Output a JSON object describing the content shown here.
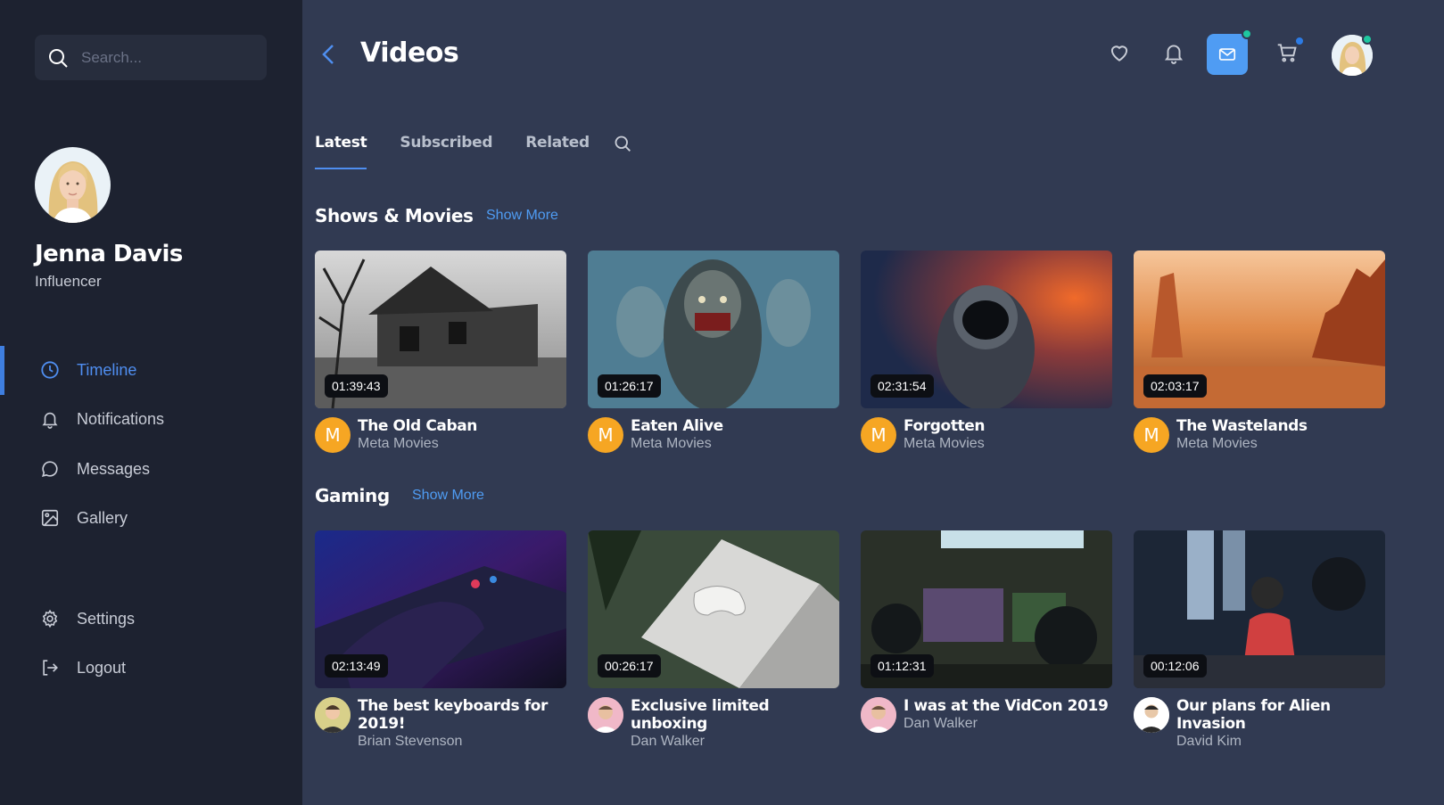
{
  "sidebar": {
    "search_placeholder": "Search...",
    "profile": {
      "name": "Jenna Davis",
      "role": "Influencer"
    },
    "nav": [
      {
        "label": "Timeline",
        "icon": "clock-icon",
        "active": true
      },
      {
        "label": "Notifications",
        "icon": "bell-icon"
      },
      {
        "label": "Messages",
        "icon": "chat-bubble-icon"
      },
      {
        "label": "Gallery",
        "icon": "image-icon"
      }
    ],
    "bottom_nav": [
      {
        "label": "Settings",
        "icon": "gear-icon"
      },
      {
        "label": "Logout",
        "icon": "logout-icon"
      }
    ]
  },
  "header": {
    "title": "Videos",
    "icons": [
      "heart-icon",
      "bell-icon",
      "mail-icon",
      "cart-icon"
    ],
    "accent": "#4f9cf3",
    "badge_colors": {
      "mail": "#1fc8a0",
      "cart": "#2c7be5",
      "avatar": "#1fc8a0"
    }
  },
  "tabs": [
    {
      "label": "Latest",
      "active": true
    },
    {
      "label": "Subscribed"
    },
    {
      "label": "Related"
    }
  ],
  "sections": [
    {
      "title": "Shows & Movies",
      "show_more": "Show More",
      "videos": [
        {
          "title": "The Old Caban",
          "channel": "Meta Movies",
          "duration": "01:39:43"
        },
        {
          "title": "Eaten Alive",
          "channel": "Meta Movies",
          "duration": "01:26:17"
        },
        {
          "title": "Forgotten",
          "channel": "Meta Movies",
          "duration": "02:31:54"
        },
        {
          "title": "The Wastelands",
          "channel": "Meta Movies",
          "duration": "02:03:17"
        }
      ]
    },
    {
      "title": "Gaming",
      "show_more": "Show More",
      "videos": [
        {
          "title": "The best keyboards for 2019!",
          "channel": "Brian Stevenson",
          "duration": "02:13:49"
        },
        {
          "title": "Exclusive limited unboxing",
          "channel": "Dan Walker",
          "duration": "00:26:17"
        },
        {
          "title": "I was at the VidCon 2019",
          "channel": "Dan Walker",
          "duration": "01:12:31"
        },
        {
          "title": "Our plans for Alien Invasion",
          "channel": "David Kim",
          "duration": "00:12:06"
        }
      ]
    }
  ],
  "channel_logo_letter": "M"
}
